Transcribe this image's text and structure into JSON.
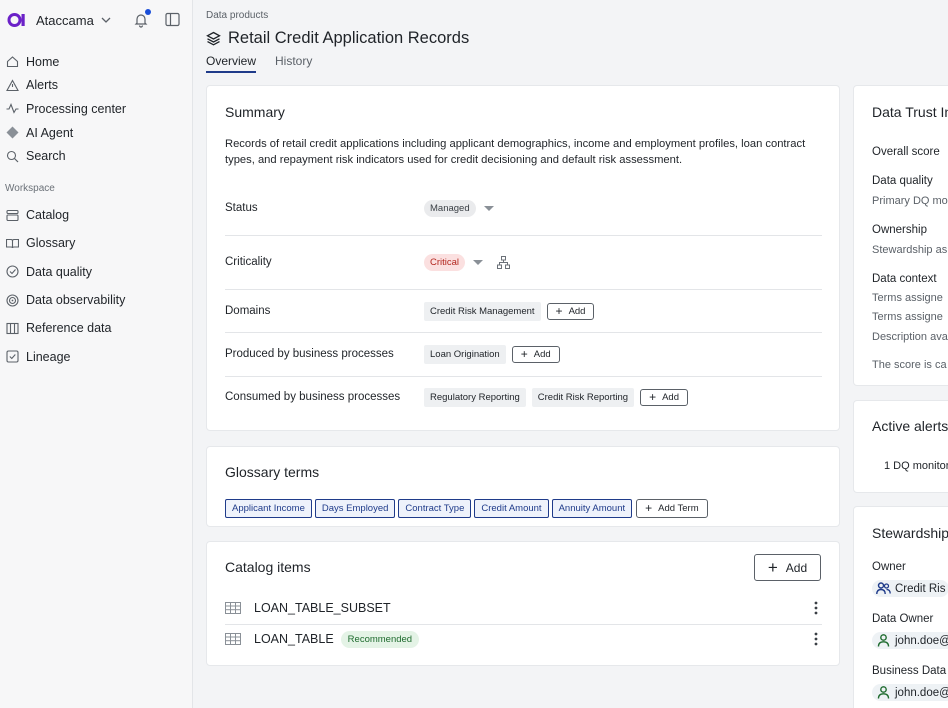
{
  "sidebar": {
    "brand": "Ataccama",
    "nav": [
      {
        "label": "Home"
      },
      {
        "label": "Alerts"
      },
      {
        "label": "Processing center"
      },
      {
        "label": "AI Agent"
      },
      {
        "label": "Search"
      }
    ],
    "workspace_label": "Workspace",
    "workspace": [
      {
        "label": "Catalog"
      },
      {
        "label": "Glossary"
      },
      {
        "label": "Data quality"
      },
      {
        "label": "Data observability"
      },
      {
        "label": "Reference data"
      },
      {
        "label": "Lineage"
      }
    ]
  },
  "header": {
    "breadcrumb": "Data products",
    "title": "Retail Credit Application Records",
    "tabs": [
      "Overview",
      "History"
    ]
  },
  "summary": {
    "heading": "Summary",
    "description": "Records of retail credit applications including applicant demographics, income and employment profiles, loan contract types, and repayment risk indicators used for credit decisioning and default risk assessment.",
    "status_label": "Status",
    "status_value": "Managed",
    "criticality_label": "Criticality",
    "criticality_value": "Critical",
    "domains_label": "Domains",
    "domains": [
      "Credit Risk Management"
    ],
    "produced_label": "Produced by business processes",
    "produced": [
      "Loan Origination"
    ],
    "consumed_label": "Consumed by business processes",
    "consumed": [
      "Regulatory Reporting",
      "Credit Risk Reporting"
    ],
    "add_label": "Add"
  },
  "glossary": {
    "heading": "Glossary terms",
    "terms": [
      "Applicant Income",
      "Days Employed",
      "Contract Type",
      "Credit Amount",
      "Annuity Amount"
    ],
    "add_term_label": "Add Term"
  },
  "catalog": {
    "heading": "Catalog items",
    "add_label": "Add",
    "items": [
      {
        "name": "LOAN_TABLE_SUBSET",
        "badge": ""
      },
      {
        "name": "LOAN_TABLE",
        "badge": "Recommended"
      }
    ]
  },
  "trust": {
    "heading": "Data Trust In",
    "overall": "Overall score",
    "dq": "Data quality",
    "dq_sub": "Primary DQ mo",
    "ownership": "Ownership",
    "ownership_sub": "Stewardship as",
    "context": "Data context",
    "context_1": "Terms assigne",
    "context_2": "Terms assigne",
    "context_3": "Description ava",
    "footer": "The score is ca"
  },
  "alerts": {
    "heading": "Active alerts",
    "item": "1 DQ monitor"
  },
  "stewardship": {
    "heading": "Stewardship",
    "owner_label": "Owner",
    "owner_value": "Credit Ris",
    "data_owner_label": "Data Owner",
    "data_owner_value": "john.doe@",
    "business_label": "Business Data",
    "business_value": "john.doe@"
  },
  "colors": {
    "accent": "#1f3b8a",
    "critical": "#b3261e",
    "recommended": "#1e6b2e",
    "brand": "#6b21c8"
  }
}
